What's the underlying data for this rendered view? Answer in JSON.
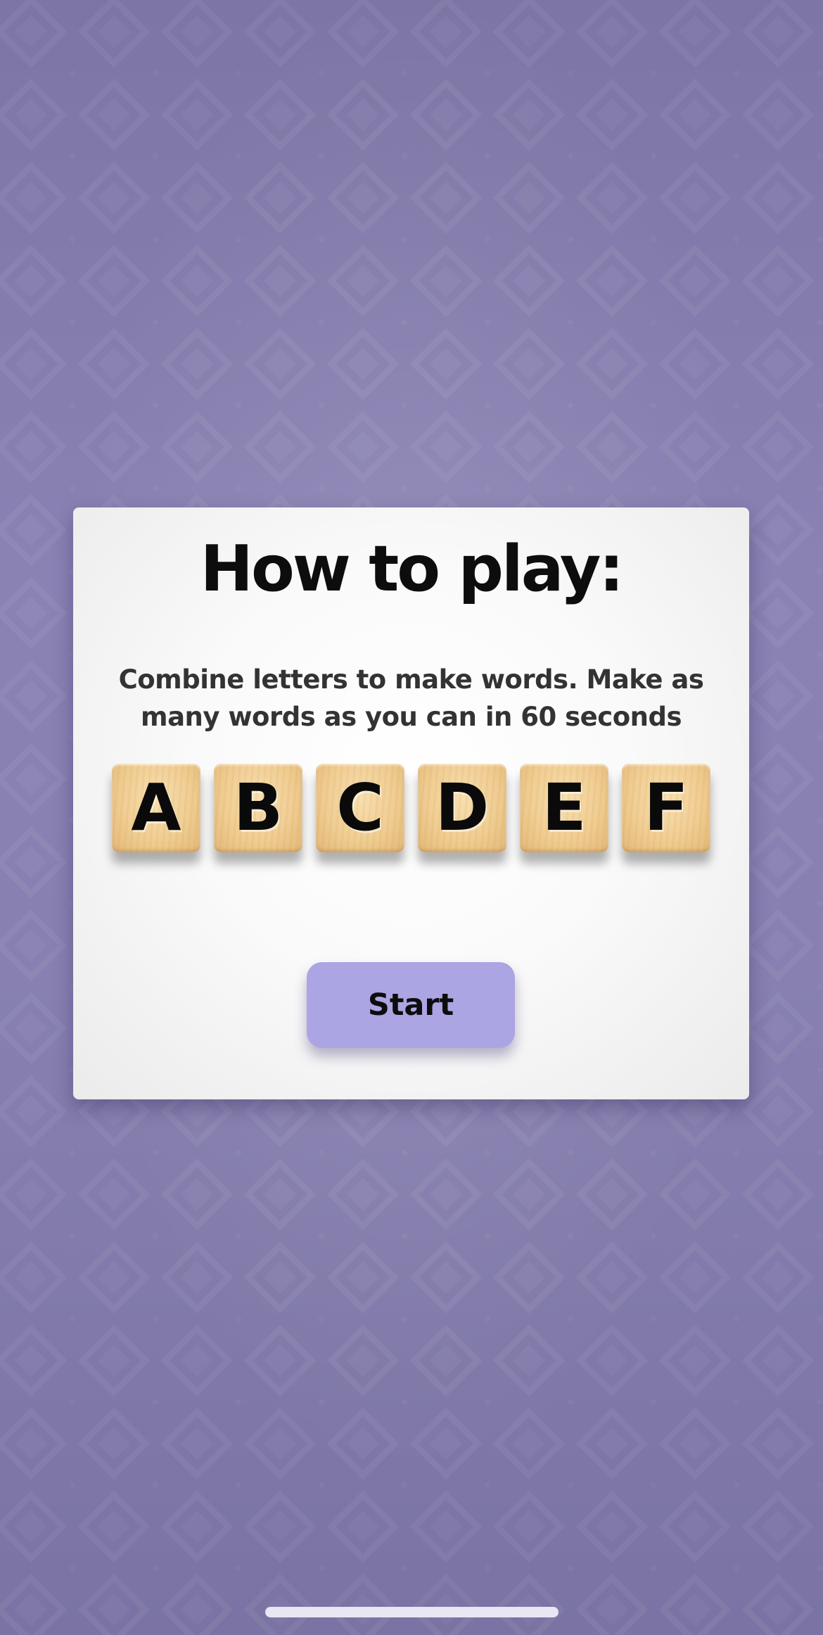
{
  "colors": {
    "background": "#847DAE",
    "card": "#FFFFFF",
    "button": "#ACA5E3",
    "tile_wood": "#F0CD92",
    "text": "#0D0D0D"
  },
  "card": {
    "title": "How to play:",
    "description": "Combine letters to make words. Make as many words as you can in 60 seconds",
    "tiles": [
      "A",
      "B",
      "C",
      "D",
      "E",
      "F"
    ],
    "start_label": "Start"
  }
}
